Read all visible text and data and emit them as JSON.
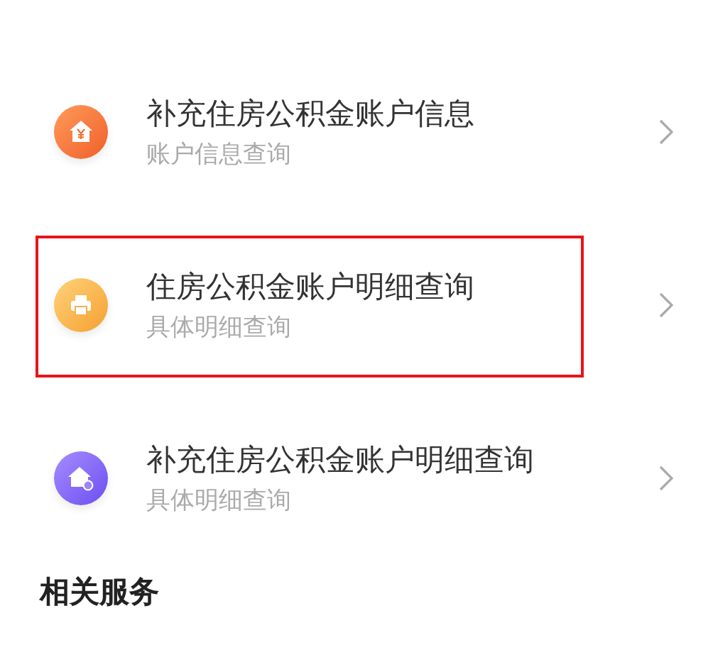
{
  "items": [
    {
      "kind": "house-yen",
      "title": "补充住房公积金账户信息",
      "subtitle": "账户信息查询",
      "highlighted": false
    },
    {
      "kind": "printer",
      "title": "住房公积金账户明细查询",
      "subtitle": "具体明细查询",
      "highlighted": true
    },
    {
      "kind": "house-badge",
      "title": "补充住房公积金账户明细查询",
      "subtitle": "具体明细查询",
      "highlighted": false
    }
  ],
  "section_title": "相关服务"
}
